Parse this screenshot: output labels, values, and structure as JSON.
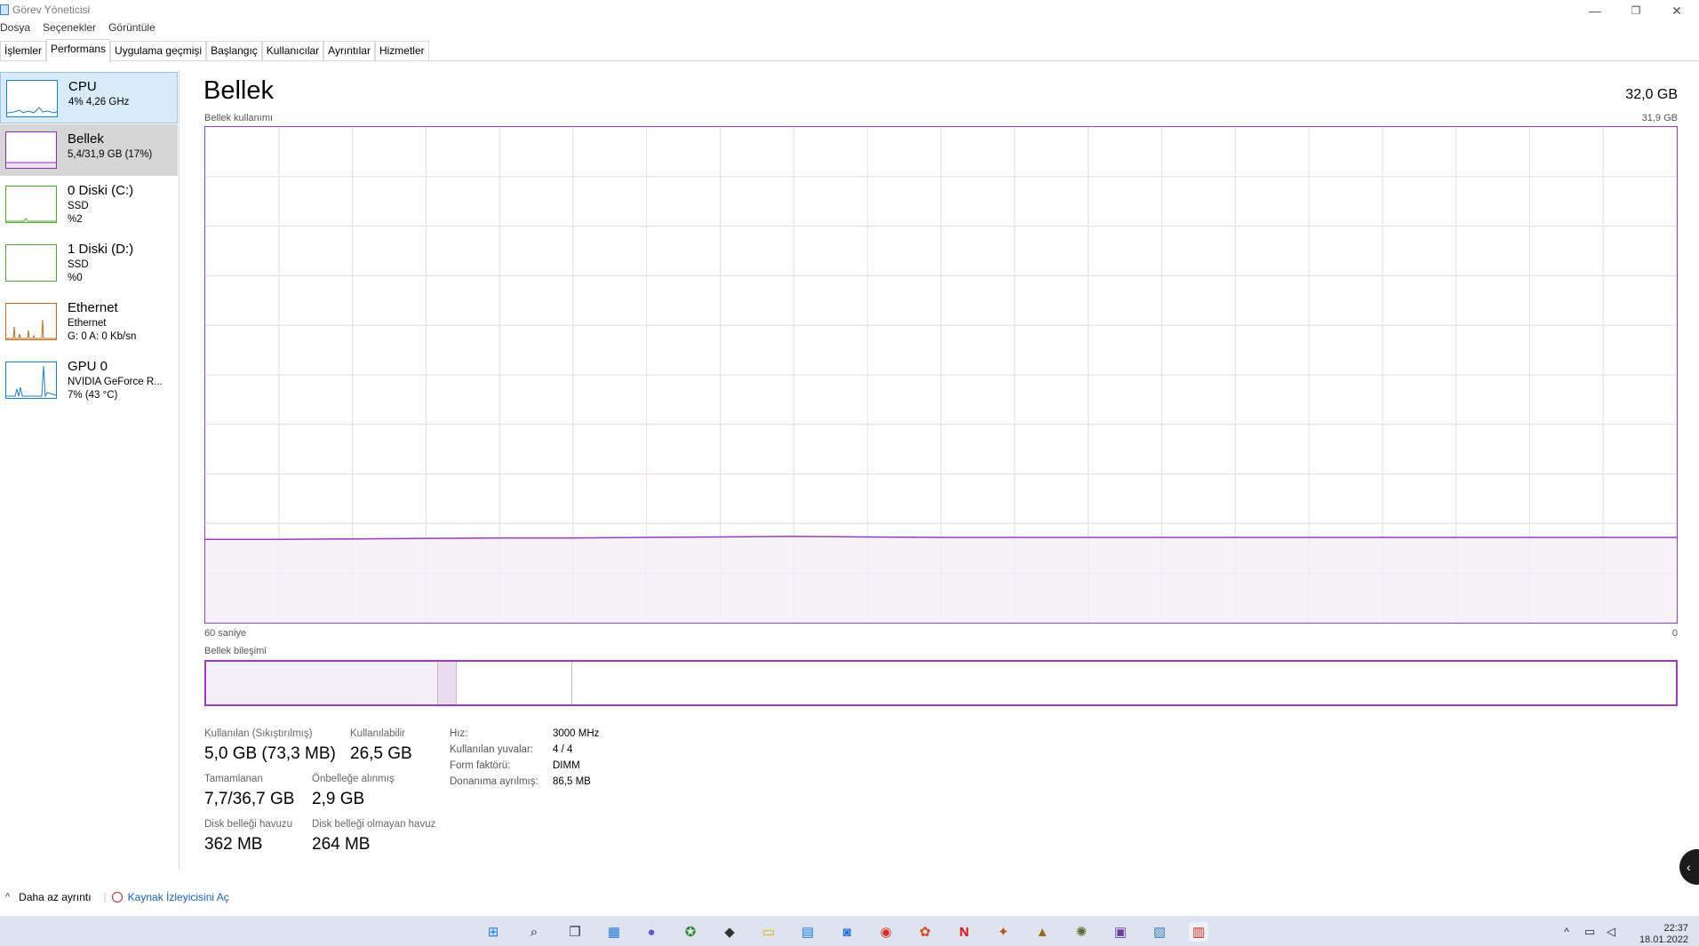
{
  "window": {
    "title": "Görev Yöneticisi",
    "buttons": {
      "minimize": "—",
      "maximize": "❐",
      "close": "✕"
    }
  },
  "menu": [
    "Dosya",
    "Seçenekler",
    "Görüntüle"
  ],
  "tabs": [
    {
      "label": "İşlemler",
      "active": false
    },
    {
      "label": "Performans",
      "active": true
    },
    {
      "label": "Uygulama geçmişi",
      "active": false
    },
    {
      "label": "Başlangıç",
      "active": false
    },
    {
      "label": "Kullanıcılar",
      "active": false
    },
    {
      "label": "Ayrıntılar",
      "active": false
    },
    {
      "label": "Hizmetler",
      "active": false
    }
  ],
  "sidebar": {
    "items": [
      {
        "title": "CPU",
        "line1": "4% 4,26 GHz",
        "line2": "",
        "color": "#1a7fc7"
      },
      {
        "title": "Bellek",
        "line1": "5,4/31,9 GB (17%)",
        "line2": "",
        "color": "#8b2fb0"
      },
      {
        "title": "0 Diski (C:)",
        "line1": "SSD",
        "line2": "%2",
        "color": "#4da52b"
      },
      {
        "title": "1 Diski (D:)",
        "line1": "SSD",
        "line2": "%0",
        "color": "#4da52b"
      },
      {
        "title": "Ethernet",
        "line1": "Ethernet",
        "line2": "G: 0 A: 0 Kb/sn",
        "color": "#c06a1e"
      },
      {
        "title": "GPU 0",
        "line1": "NVIDIA GeForce R...",
        "line2": "7% (43 °C)",
        "color": "#1a7fc7"
      }
    ]
  },
  "main": {
    "title": "Bellek",
    "total": "32,0 GB",
    "graph_label": "Bellek kullanımı",
    "graph_max": "31,9 GB",
    "axis_left": "60 saniye",
    "axis_right": "0",
    "composition_label": "Bellek bileşimi"
  },
  "stats": {
    "in_use_label": "Kullanılan (Sıkıştırılmış)",
    "in_use_value": "5,0 GB (73,3 MB)",
    "available_label": "Kullanılabilir",
    "available_value": "26,5 GB",
    "committed_label": "Tamamlanan",
    "committed_value": "7,7/36,7 GB",
    "cached_label": "Önbelleğe alınmış",
    "cached_value": "2,9 GB",
    "paged_label": "Disk belleği havuzu",
    "paged_value": "362 MB",
    "nonpaged_label": "Disk belleği olmayan havuz",
    "nonpaged_value": "264 MB"
  },
  "info": [
    {
      "key": "Hız:",
      "value": "3000 MHz"
    },
    {
      "key": "Kullanılan yuvalar:",
      "value": "4 / 4"
    },
    {
      "key": "Form faktörü:",
      "value": "DIMM"
    },
    {
      "key": "Donanıma ayrılmış:",
      "value": "86,5 MB"
    }
  ],
  "bottom": {
    "less_details": "Daha az ayrıntı",
    "resource_monitor": "Kaynak İzleyicisini Aç"
  },
  "taskbar": {
    "time": "22:37",
    "date": "18.01.2022"
  },
  "colors": {
    "memory_accent": "#9a3bc2",
    "memory_fill": "#f3eff6",
    "grid": "#e6dcea"
  },
  "memory_history_fraction": [
    0.168,
    0.168,
    0.169,
    0.17,
    0.171,
    0.171,
    0.172,
    0.173,
    0.174,
    0.173,
    0.172,
    0.172,
    0.172,
    0.172,
    0.172,
    0.172,
    0.172,
    0.172,
    0.172,
    0.172,
    0.172
  ],
  "composition_fraction": {
    "in_use": 0.157,
    "modified": 0.013,
    "standby": 0.078
  }
}
